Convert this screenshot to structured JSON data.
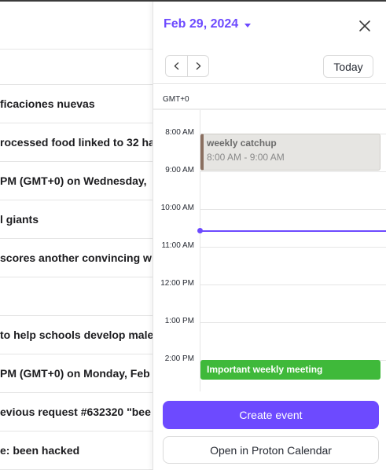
{
  "mail_list": {
    "rows": [
      "ficaciones nuevas",
      "rocessed food linked to 32 ha",
      "PM (GMT+0) on Wednesday,",
      "l giants",
      "scores another convincing wi",
      "",
      "to help schools develop male",
      "PM (GMT+0) on Monday, Feb",
      "evious request #632320 \"bee",
      "e: been hacked"
    ]
  },
  "calendar": {
    "date_label": "Feb 29, 2024",
    "today_label": "Today",
    "timezone": "GMT+0",
    "hours": [
      "8:00 AM",
      "9:00 AM",
      "10:00 AM",
      "11:00 AM",
      "12:00 PM",
      "1:00 PM",
      "2:00 PM"
    ],
    "events": [
      {
        "title": "weekly catchup",
        "time": "8:00 AM - 9:00 AM",
        "color": "#8a6f60"
      },
      {
        "title": "Important weekly meeting",
        "time": "",
        "color": "#3fb93a"
      }
    ],
    "create_label": "Create event",
    "open_label": "Open in Proton Calendar"
  },
  "colors": {
    "accent": "#6d4aff",
    "event_green": "#3fb93a"
  }
}
